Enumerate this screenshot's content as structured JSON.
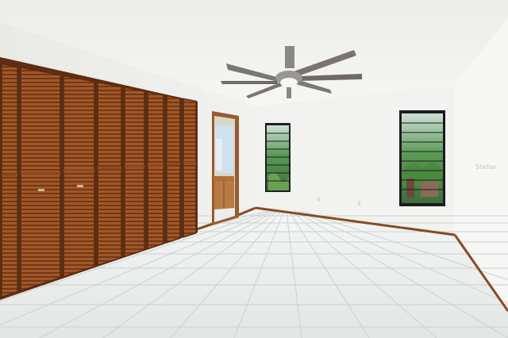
{
  "watermark": {
    "text": "Stellar"
  },
  "colors": {
    "ceiling": "#f4f5f3",
    "wall_back": "#f2f2f0",
    "wall_left": "#eeeeec",
    "wall_right": "#f6f6f4",
    "floor": "#e8ebea",
    "grout": "#cfd3d2",
    "wood": "#a5582a",
    "wood_dark": "#6e3614",
    "baseboard": "#8a4a22",
    "window_green": "#4f8f4a",
    "fan_metal": "#8a8784"
  }
}
